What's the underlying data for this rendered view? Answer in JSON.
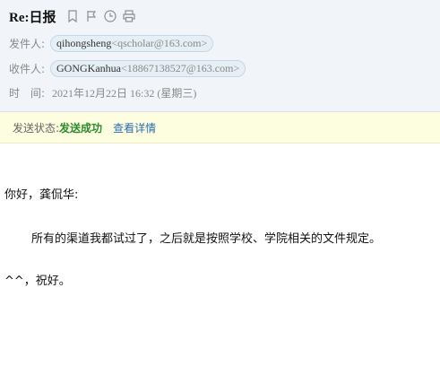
{
  "mail": {
    "subject": "Re:日报",
    "tool_icons": [
      "bookmark-icon",
      "flag-icon",
      "clock-icon",
      "print-icon"
    ],
    "from": {
      "label": "发件人:",
      "name": "qihongsheng",
      "address": "<qscholar@163.com>"
    },
    "to": {
      "label": "收件人:",
      "name": "GONGKanhua",
      "address": "<18867138527@163.com>"
    },
    "time": {
      "label": "时　间:",
      "value": "2021年12月22日 16:32 (星期三)"
    }
  },
  "status": {
    "label": "发送状态:",
    "value": "发送成功",
    "detail_link": "查看详情"
  },
  "body": {
    "greeting": "你好，龚侃华:",
    "paragraph": "所有的渠道我都试过了，之后就是按照学校、学院相关的文件规定。",
    "closing": "^^，祝好。"
  },
  "colors": {
    "header_bg": "#f1f5fa",
    "status_bg": "#fdfde0",
    "success": "#2e8b2e",
    "link": "#2b6cb0"
  }
}
